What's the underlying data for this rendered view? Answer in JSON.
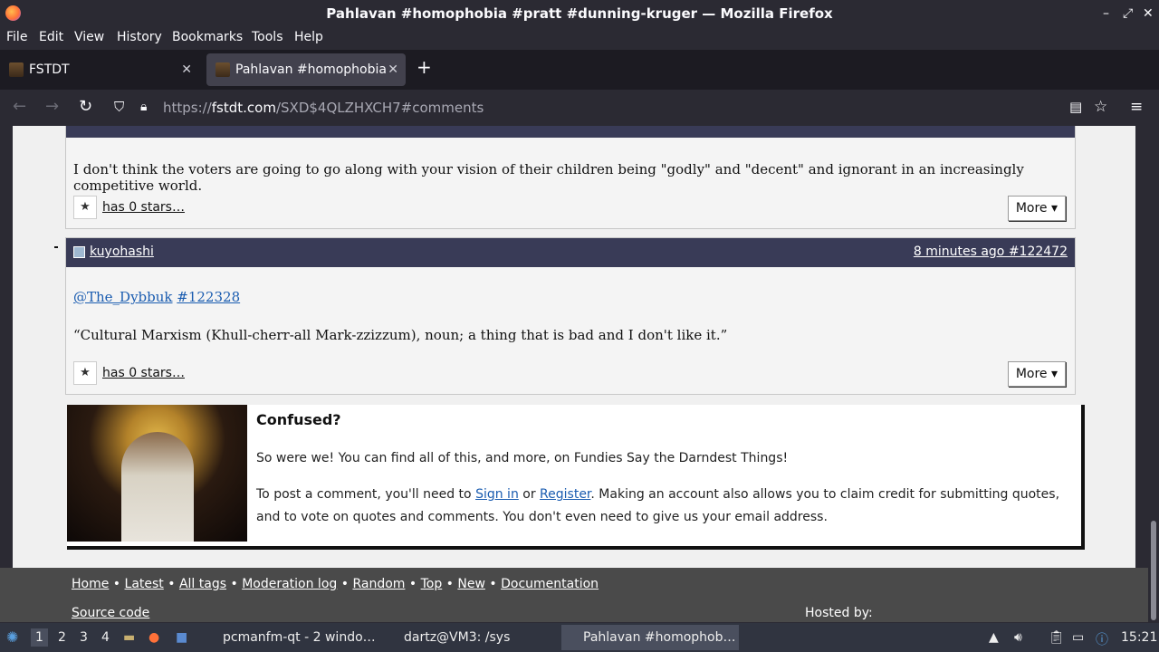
{
  "window": {
    "title": "Pahlavan #homophobia #pratt #dunning-kruger — Mozilla Firefox",
    "controls": [
      "–",
      "⤢",
      "✕"
    ]
  },
  "menu": [
    "File",
    "Edit",
    "View",
    "History",
    "Bookmarks",
    "Tools",
    "Help"
  ],
  "tabs": [
    {
      "label": "FSTDT",
      "active": false
    },
    {
      "label": "Pahlavan #homophobia",
      "active": true
    }
  ],
  "newtab": "+",
  "nav": {
    "back": "←",
    "forward": "→",
    "reload": "↻",
    "url_prefix": "https://",
    "url_domain": "fstdt.com",
    "url_path": "/SXD$4QLZHXCH7#comments"
  },
  "comments": [
    {
      "user": "",
      "meta": "",
      "text": "I don't think the voters are going to go along with your vision of their children being \"godly\" and \"decent\" and ignorant in an increasingly competitive world.",
      "stars": "has 0 stars…",
      "more": "More ▾"
    },
    {
      "user": "kuyohashi",
      "meta": "8 minutes ago #122472",
      "mention": "@The_Dybbuk",
      "mention_ref": "#122328",
      "text": "“Cultural Marxism (Khull-cherr-all Mark-zzizzum), noun; a thing that is bad and I don't like it.”",
      "stars": "has 0 stars…",
      "more": "More ▾"
    }
  ],
  "confused": {
    "title": "Confused?",
    "p1": "So were we! You can find all of this, and more, on Fundies Say the Darndest Things!",
    "p2_a": "To post a comment, you'll need to ",
    "signin": "Sign in",
    "p2_b": " or ",
    "register": "Register",
    "p2_c": ". Making an account also allows you to claim credit for submitting quotes, and to vote on quotes and comments. You don't even need to give us your email address."
  },
  "footer": {
    "links": [
      "Home",
      "Latest",
      "All tags",
      "Moderation log",
      "Random",
      "Top",
      "New",
      "Documentation"
    ],
    "source": "Source code",
    "hosted": "Hosted by:"
  },
  "taskbar": {
    "desktops": [
      "1",
      "2",
      "3",
      "4"
    ],
    "windows": [
      "pcmanfm-qt - 2 windo…",
      "dartz@VM3: /sys",
      "Pahlavan #homophob…"
    ],
    "clock": "15:21"
  }
}
